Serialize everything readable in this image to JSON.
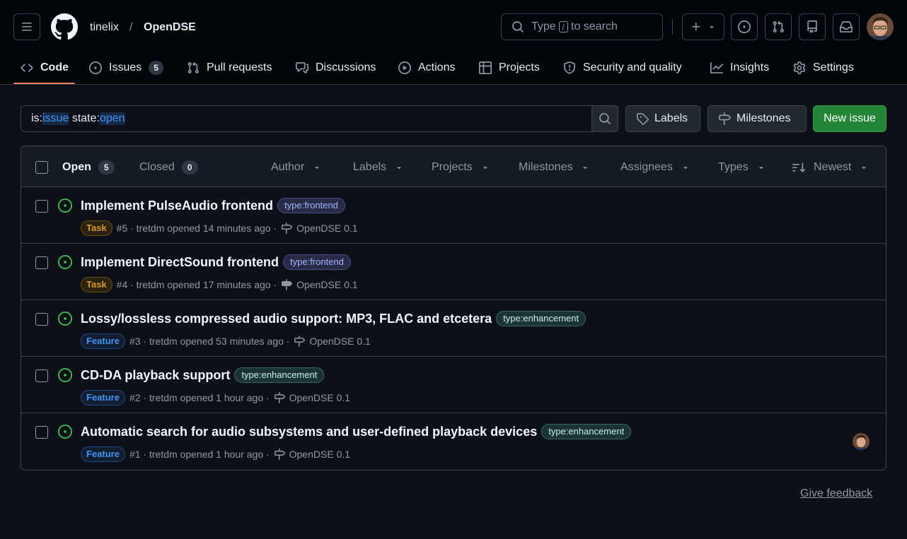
{
  "header": {
    "owner": "tinelix",
    "separator": "/",
    "repo": "OpenDSE",
    "search": {
      "prefix": "Type",
      "key": "/",
      "suffix": "to search"
    }
  },
  "nav": {
    "tabs": [
      {
        "label": "Code",
        "icon": "code-icon"
      },
      {
        "label": "Issues",
        "icon": "issue-opened-icon",
        "count": "5"
      },
      {
        "label": "Pull requests",
        "icon": "git-pull-request-icon"
      },
      {
        "label": "Discussions",
        "icon": "comment-discussion-icon"
      },
      {
        "label": "Actions",
        "icon": "play-icon"
      },
      {
        "label": "Projects",
        "icon": "table-icon"
      },
      {
        "label": "Security and quality",
        "icon": "shield-icon"
      },
      {
        "label": "Insights",
        "icon": "graph-icon"
      },
      {
        "label": "Settings",
        "icon": "gear-icon"
      }
    ]
  },
  "filter": {
    "is_key": "is:",
    "is_val": "issue",
    "state_key": "state:",
    "state_val": "open",
    "labels_btn": "Labels",
    "milestones_btn": "Milestones",
    "new_issue_btn": "New issue"
  },
  "list": {
    "open_label": "Open",
    "open_count": "5",
    "closed_label": "Closed",
    "closed_count": "0",
    "filters": [
      "Author",
      "Labels",
      "Projects",
      "Milestones",
      "Assignees",
      "Types",
      "Newest"
    ],
    "issues": [
      {
        "title": "Implement PulseAudio frontend",
        "label": "type:frontend",
        "label_kind": "frontend",
        "type": "Task",
        "meta": "#5 · tretdm opened 14 minutes ago ·",
        "milestone": "OpenDSE 0.1",
        "assignee": false
      },
      {
        "title": "Implement DirectSound frontend",
        "label": "type:frontend",
        "label_kind": "frontend",
        "type": "Task",
        "meta": "#4 · tretdm opened 17 minutes ago ·",
        "milestone": "OpenDSE 0.1",
        "assignee": false
      },
      {
        "title": "Lossy/lossless compressed audio support: MP3, FLAC and etcetera",
        "label": "type:enhancement",
        "label_kind": "enh",
        "type": "Feature",
        "meta": "#3 · tretdm opened 53 minutes ago ·",
        "milestone": "OpenDSE 0.1",
        "assignee": false
      },
      {
        "title": "CD-DA playback support",
        "label": "type:enhancement",
        "label_kind": "enh",
        "type": "Feature",
        "meta": "#2 · tretdm opened 1 hour ago ·",
        "milestone": "OpenDSE 0.1",
        "assignee": false
      },
      {
        "title": "Automatic search for audio subsystems and user-defined playback devices",
        "label": "type:enhancement",
        "label_kind": "enh",
        "type": "Feature",
        "meta": "#1 · tretdm opened 1 hour ago ·",
        "milestone": "OpenDSE 0.1",
        "assignee": true
      }
    ]
  },
  "footer": {
    "feedback": "Give feedback"
  },
  "colors": {
    "accent_underline": "#f78166",
    "open_green": "#3fb950",
    "new_btn": "#238636"
  }
}
